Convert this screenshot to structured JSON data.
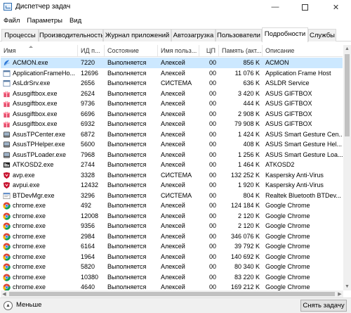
{
  "window": {
    "title": "Диспетчер задач",
    "minimize_glyph": "—",
    "close_glyph": "✕"
  },
  "menu": [
    "Файл",
    "Параметры",
    "Вид"
  ],
  "tabs": [
    {
      "label": "Процессы",
      "active": false
    },
    {
      "label": "Производительность",
      "active": false
    },
    {
      "label": "Журнал приложений",
      "active": false
    },
    {
      "label": "Автозагрузка",
      "active": false
    },
    {
      "label": "Пользователи",
      "active": false
    },
    {
      "label": "Подробности",
      "active": true
    },
    {
      "label": "Службы",
      "active": false
    }
  ],
  "columns": [
    "Имя",
    "ИД п...",
    "Состояние",
    "Имя польз...",
    "ЦП",
    "Память (акт...",
    "Описание"
  ],
  "processes": [
    {
      "name": "ACMON.exe",
      "pid": "7220",
      "status": "Выполняется",
      "user": "Алексей",
      "cpu": "00",
      "memory": "856 K",
      "description": "ACMON",
      "icon": "acmon-icon",
      "selected": true
    },
    {
      "name": "ApplicationFrameHo...",
      "pid": "12696",
      "status": "Выполняется",
      "user": "Алексей",
      "cpu": "00",
      "memory": "11 076 K",
      "description": "Application Frame Host",
      "icon": "window-icon",
      "selected": false
    },
    {
      "name": "AsLdrSrv.exe",
      "pid": "2656",
      "status": "Выполняется",
      "user": "СИСТЕМА",
      "cpu": "00",
      "memory": "636 K",
      "description": "ASLDR Service",
      "icon": "window-icon",
      "selected": false
    },
    {
      "name": "Asusgiftbox.exe",
      "pid": "2624",
      "status": "Выполняется",
      "user": "Алексей",
      "cpu": "00",
      "memory": "3 420 K",
      "description": "ASUS GIFTBOX",
      "icon": "gift-icon",
      "selected": false
    },
    {
      "name": "Asusgiftbox.exe",
      "pid": "9736",
      "status": "Выполняется",
      "user": "Алексей",
      "cpu": "00",
      "memory": "444 K",
      "description": "ASUS GIFTBOX",
      "icon": "gift-icon",
      "selected": false
    },
    {
      "name": "Asusgiftbox.exe",
      "pid": "6696",
      "status": "Выполняется",
      "user": "Алексей",
      "cpu": "00",
      "memory": "2 908 K",
      "description": "ASUS GIFTBOX",
      "icon": "gift-icon",
      "selected": false
    },
    {
      "name": "Asusgiftbox.exe",
      "pid": "6932",
      "status": "Выполняется",
      "user": "Алексей",
      "cpu": "00",
      "memory": "79 908 K",
      "description": "ASUS GIFTBOX",
      "icon": "gift-icon",
      "selected": false
    },
    {
      "name": "AsusTPCenter.exe",
      "pid": "6872",
      "status": "Выполняется",
      "user": "Алексей",
      "cpu": "00",
      "memory": "1 424 K",
      "description": "ASUS Smart Gesture Cen...",
      "icon": "touchpad-icon",
      "selected": false
    },
    {
      "name": "AsusTPHelper.exe",
      "pid": "5600",
      "status": "Выполняется",
      "user": "Алексей",
      "cpu": "00",
      "memory": "408 K",
      "description": "ASUS Smart Gesture Hel...",
      "icon": "touchpad-icon",
      "selected": false
    },
    {
      "name": "AsusTPLoader.exe",
      "pid": "7968",
      "status": "Выполняется",
      "user": "Алексей",
      "cpu": "00",
      "memory": "1 256 K",
      "description": "ASUS Smart Gesture Loa...",
      "icon": "touchpad-icon",
      "selected": false
    },
    {
      "name": "ATKOSD2.exe",
      "pid": "2744",
      "status": "Выполняется",
      "user": "Алексей",
      "cpu": "00",
      "memory": "1 464 K",
      "description": "ATKOSD2",
      "icon": "osd-icon",
      "selected": false
    },
    {
      "name": "avp.exe",
      "pid": "3328",
      "status": "Выполняется",
      "user": "СИСТЕМА",
      "cpu": "00",
      "memory": "132 252 K",
      "description": "Kaspersky Anti-Virus",
      "icon": "kaspersky-icon",
      "selected": false
    },
    {
      "name": "avpui.exe",
      "pid": "12432",
      "status": "Выполняется",
      "user": "Алексей",
      "cpu": "00",
      "memory": "1 920 K",
      "description": "Kaspersky Anti-Virus",
      "icon": "kaspersky-icon",
      "selected": false
    },
    {
      "name": "BTDevMgr.exe",
      "pid": "3296",
      "status": "Выполняется",
      "user": "СИСТЕМА",
      "cpu": "00",
      "memory": "804 K",
      "description": "Realtek Bluetooth BTDev...",
      "icon": "bluetooth-icon",
      "selected": false
    },
    {
      "name": "chrome.exe",
      "pid": "492",
      "status": "Выполняется",
      "user": "Алексей",
      "cpu": "00",
      "memory": "124 184 K",
      "description": "Google Chrome",
      "icon": "chrome-icon",
      "selected": false
    },
    {
      "name": "chrome.exe",
      "pid": "12008",
      "status": "Выполняется",
      "user": "Алексей",
      "cpu": "00",
      "memory": "2 120 K",
      "description": "Google Chrome",
      "icon": "chrome-icon",
      "selected": false
    },
    {
      "name": "chrome.exe",
      "pid": "9356",
      "status": "Выполняется",
      "user": "Алексей",
      "cpu": "00",
      "memory": "2 120 K",
      "description": "Google Chrome",
      "icon": "chrome-icon",
      "selected": false
    },
    {
      "name": "chrome.exe",
      "pid": "2984",
      "status": "Выполняется",
      "user": "Алексей",
      "cpu": "00",
      "memory": "346 076 K",
      "description": "Google Chrome",
      "icon": "chrome-icon",
      "selected": false
    },
    {
      "name": "chrome.exe",
      "pid": "6164",
      "status": "Выполняется",
      "user": "Алексей",
      "cpu": "00",
      "memory": "39 792 K",
      "description": "Google Chrome",
      "icon": "chrome-icon",
      "selected": false
    },
    {
      "name": "chrome.exe",
      "pid": "1964",
      "status": "Выполняется",
      "user": "Алексей",
      "cpu": "00",
      "memory": "140 692 K",
      "description": "Google Chrome",
      "icon": "chrome-icon",
      "selected": false
    },
    {
      "name": "chrome.exe",
      "pid": "5820",
      "status": "Выполняется",
      "user": "Алексей",
      "cpu": "00",
      "memory": "80 340 K",
      "description": "Google Chrome",
      "icon": "chrome-icon",
      "selected": false
    },
    {
      "name": "chrome.exe",
      "pid": "10380",
      "status": "Выполняется",
      "user": "Алексей",
      "cpu": "00",
      "memory": "83 220 K",
      "description": "Google Chrome",
      "icon": "chrome-icon",
      "selected": false
    },
    {
      "name": "chrome.exe",
      "pid": "4640",
      "status": "Выполняется",
      "user": "Алексей",
      "cpu": "00",
      "memory": "169 212 K",
      "description": "Google Chrome",
      "icon": "chrome-icon",
      "selected": false
    }
  ],
  "footer": {
    "fewer_label": "Меньше",
    "fewer_glyph": "▲",
    "end_task_label": "Снять задачу"
  },
  "colors": {
    "selected_row": "#cce8ff",
    "tab_inactive_bg": "#f0f0f0",
    "chrome_red": "#db4437",
    "chrome_green": "#0f9d58",
    "chrome_yellow": "#f4b400",
    "chrome_blue": "#4285f4",
    "kaspersky_red": "#c8102e"
  }
}
